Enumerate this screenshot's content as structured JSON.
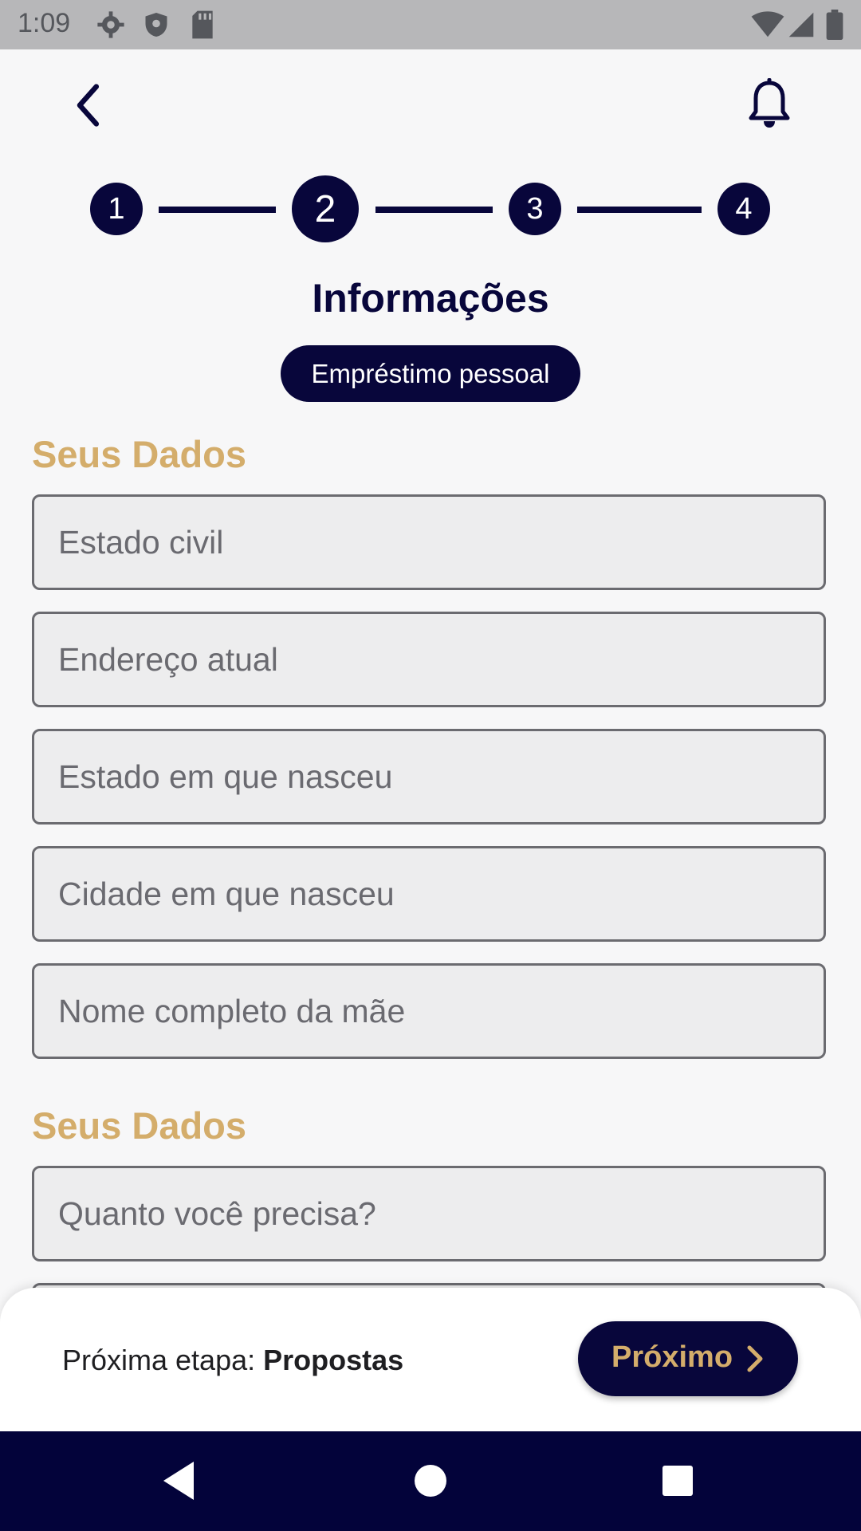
{
  "status_bar": {
    "time": "1:09"
  },
  "stepper": {
    "steps": [
      "1",
      "2",
      "3",
      "4"
    ],
    "current_step": 2
  },
  "page": {
    "title": "Informações",
    "badge": "Empréstimo pessoal"
  },
  "sections": [
    {
      "title": "Seus Dados",
      "fields": [
        {
          "placeholder": "Estado civil",
          "value": ""
        },
        {
          "placeholder": "Endereço atual",
          "value": ""
        },
        {
          "placeholder": "Estado em que nasceu",
          "value": ""
        },
        {
          "placeholder": "Cidade em que nasceu",
          "value": ""
        },
        {
          "placeholder": "Nome completo da mãe",
          "value": ""
        }
      ]
    },
    {
      "title": "Seus Dados",
      "fields": [
        {
          "placeholder": "Quanto você precisa?",
          "value": ""
        }
      ]
    }
  ],
  "footer": {
    "next_step_label": "Próxima etapa:",
    "next_step_value": "Propostas",
    "next_button": "Próximo"
  },
  "icons": [
    "settings-icon",
    "shield-icon",
    "sd-card-icon",
    "wifi-icon",
    "signal-icon",
    "battery-icon",
    "back-arrow-icon",
    "bell-icon",
    "chevron-right-icon",
    "nav-back-icon",
    "nav-home-icon",
    "nav-recents-icon"
  ],
  "colors": {
    "primary": "#08063b",
    "accent": "#d4ad6b",
    "field_bg": "#ededee",
    "nav_bar": "#03033a"
  }
}
